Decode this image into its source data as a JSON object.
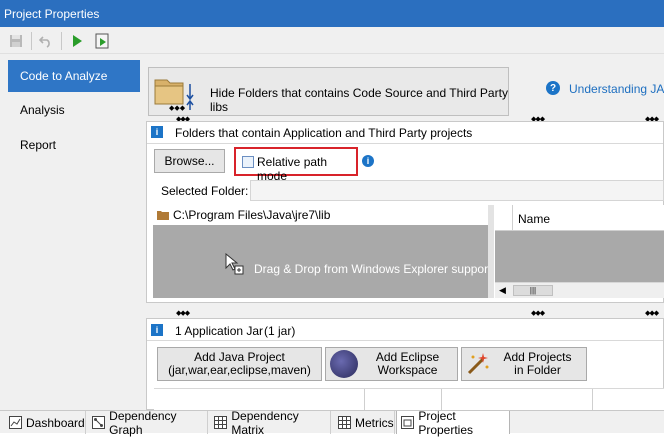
{
  "window": {
    "title": "Project Properties"
  },
  "nav": {
    "items": [
      "Code to Analyze",
      "Analysis",
      "Report"
    ]
  },
  "hide_folders_button": {
    "label": "Hide Folders that contains Code Source and Third Party libs"
  },
  "help_link": "Understanding JArc",
  "folders_panel": {
    "title": "Folders that contain Application and Third Party projects",
    "browse_label": "Browse...",
    "relative_path_label": "Relative path mode",
    "selected_folder_label": "Selected Folder:",
    "selected_folder_value": "",
    "folder_item": "C:\\Program Files\\Java\\jre7\\lib",
    "dropzone_text": "Drag & Drop from Windows Explorer supported",
    "name_column": "Name"
  },
  "app_panel": {
    "title": "1 Application Jar",
    "count": "(1 jar)",
    "add_java_label": "Add Java Project\n(jar,war,ear,eclipse,maven)",
    "add_eclipse_label": "Add Eclipse\nWorkspace",
    "add_projects_label": "Add Projects\nin Folder"
  },
  "tabs": [
    "Dashboard",
    "Dependency Graph",
    "Dependency Matrix",
    "Metrics",
    "Project Properties"
  ],
  "colors": {
    "titlebar": "#2b6fbf",
    "nav_active": "#2f76c6",
    "link": "#1e6fc0",
    "highlight": "#d8232a"
  }
}
